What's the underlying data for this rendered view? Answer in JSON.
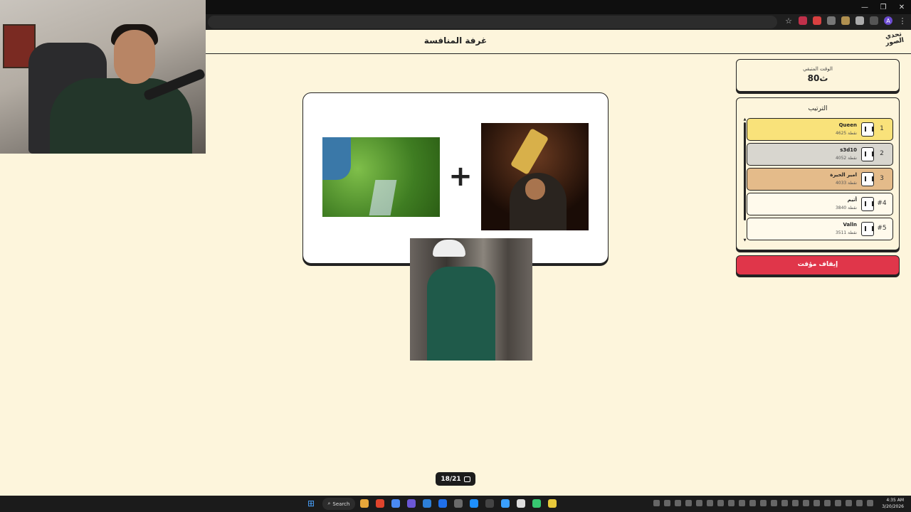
{
  "browser": {
    "window_controls": [
      "—",
      "❐",
      "✕"
    ],
    "extensions": [
      "star-icon",
      "extension-1",
      "extension-2",
      "extension-3",
      "extension-4",
      "extension-5",
      "puzzle-icon",
      "profile-avatar",
      "kebab-menu"
    ],
    "profile_initial": "A"
  },
  "header": {
    "title": "غرفة المنافسة",
    "logo_text": "تحدي الصور"
  },
  "game": {
    "plus_symbol": "+",
    "images": [
      "watering-plants-image",
      "trophy-celebration-image",
      "dancer-gif-image"
    ],
    "progress": "18/21"
  },
  "timer": {
    "label": "الوقت المتبقي",
    "value": "80ث"
  },
  "ranking": {
    "title": "الترتيب",
    "scroll_up": "▲",
    "scroll_down": "▼",
    "players": [
      {
        "rank": "1",
        "name": "Queen",
        "score": "4625 نقطة",
        "bg": "#f9e27a"
      },
      {
        "rank": "2",
        "name": "s3d10",
        "score": "4052 نقطة",
        "bg": "#d8d6cf"
      },
      {
        "rank": "3",
        "name": "امير الحيرة",
        "score": "4033 نقطة",
        "bg": "#e4bb8a"
      },
      {
        "rank": "#4",
        "name": "أتيم",
        "score": "3840 نقطة",
        "bg": "#fffaec"
      },
      {
        "rank": "#5",
        "name": "Valln",
        "score": "3511 نقطة",
        "bg": "#fffaec"
      }
    ]
  },
  "stop_button": {
    "label": "إيقاف مؤقت",
    "color": "#e0364a"
  },
  "taskbar": {
    "start_icon": "⊞",
    "search_label": "Search",
    "clock_time": "4:35 AM",
    "clock_date": "3/20/2026",
    "app_colors": [
      "#e8a73a",
      "#e0442c",
      "#4a8af4",
      "#6b57d6",
      "#2d7fd8",
      "#1f6feb",
      "#6a6a6a",
      "#1e90ff",
      "#444",
      "#3aa0ff",
      "#ddd",
      "#37c871",
      "#e8c93a"
    ]
  }
}
